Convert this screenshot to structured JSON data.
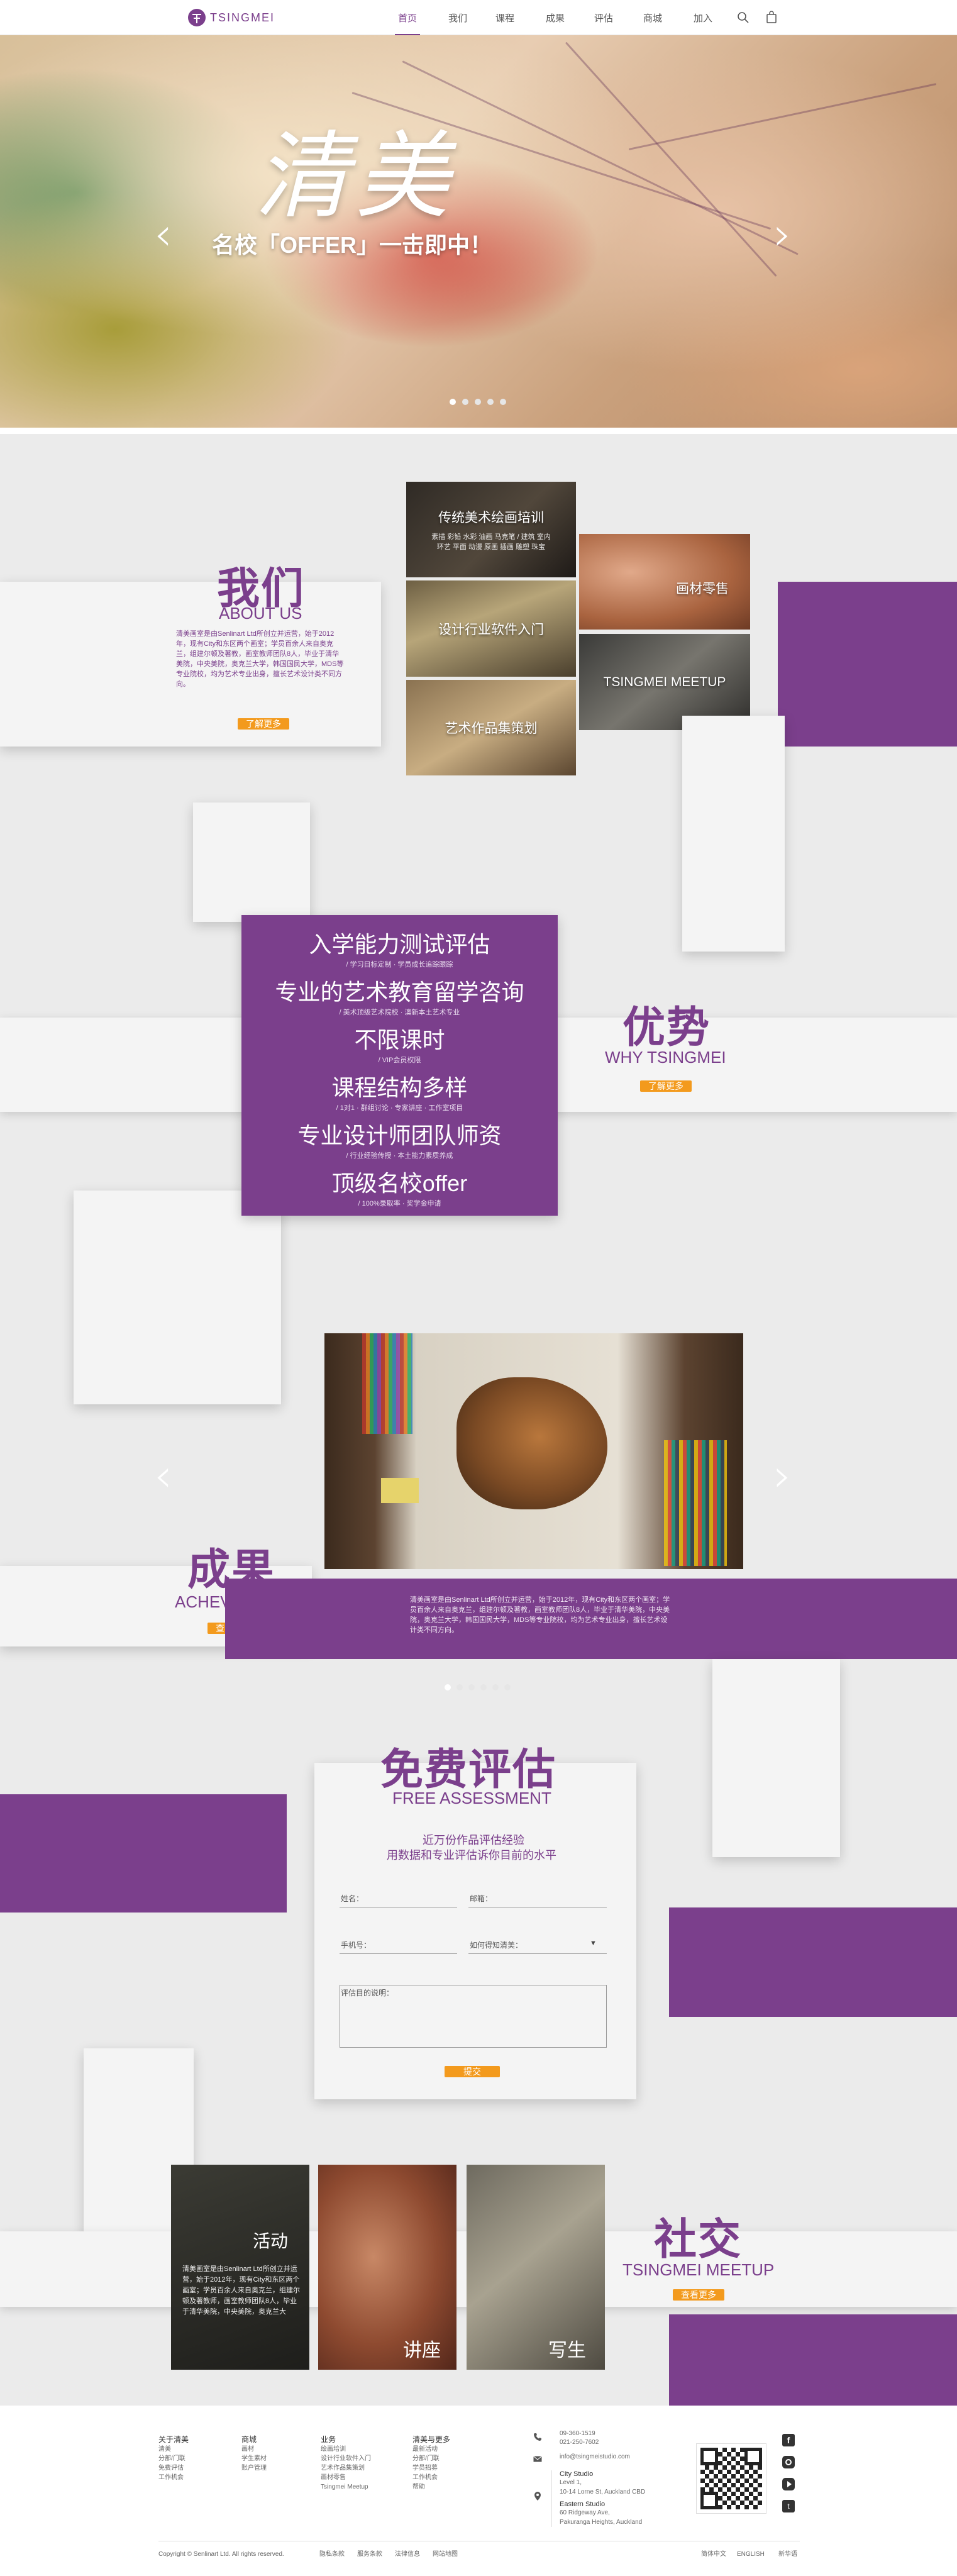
{
  "brand": {
    "logo_text": "TSINGMEI"
  },
  "nav": {
    "items": [
      {
        "label": "首页"
      },
      {
        "label": "我们"
      },
      {
        "label": "课程"
      },
      {
        "label": "成果"
      },
      {
        "label": "评估"
      },
      {
        "label": "商城"
      },
      {
        "label": "加入"
      }
    ]
  },
  "hero": {
    "calligraphy": "清美",
    "slogan": "名校「OFFER」一击即中！"
  },
  "about": {
    "title_cn": "我们",
    "title_en": "ABOUT US",
    "desc": "清美画室是由Senlinart Ltd所创立并运营，始于2012年，现有City和东区两个画室；学员百余人来自奥克兰，组建尔顿及著教，画室教师团队8人，毕业于清华美院，中央美院，奥克兰大学，韩国国民大学，MDS等专业院校，均为艺术专业出身，擅长艺术设计类不同方向。",
    "btn": "了解更多",
    "tiles": [
      {
        "title": "传统美术绘画培训",
        "sub": "素描 彩铅 水彩 油画 马克笔 / 建筑 室内 环艺 平面 动漫 原画 插画 雕塑 珠宝"
      },
      {
        "title": "画材零售"
      },
      {
        "title": "设计行业软件入门"
      },
      {
        "title": "TSINGMEI MEETUP"
      },
      {
        "title": "艺术作品集策划"
      }
    ]
  },
  "advantages": {
    "items": [
      {
        "main": "入学能力测试评估",
        "sub": "/ 学习目标定制 · 学员成长追踪跟踪"
      },
      {
        "main": "专业的艺术教育留学咨询",
        "sub": "/ 美术顶级艺术院校 · 澳新本土艺术专业"
      },
      {
        "main": "不限课时",
        "sub": "/ VIP会员权限"
      },
      {
        "main": "课程结构多样",
        "sub": "/ 1对1 · 群组讨论 · 专家讲座 · 工作室项目"
      },
      {
        "main": "专业设计师团队师资",
        "sub": "/ 行业经验传授 · 本土能力素质养成"
      },
      {
        "main": "顶级名校offer",
        "sub": "/ 100%录取率 · 奖学金申请"
      }
    ],
    "title_cn": "优势",
    "title_en": "WHY TSINGMEI",
    "btn": "了解更多"
  },
  "achievements": {
    "title_cn": "成果",
    "title_en": "ACHEVMENTS",
    "btn": "查看更多",
    "desc": "清美画室是由Senlinart Ltd所创立并运营，始于2012年，现有City和东区两个画室；学员百余人来自奥克兰，组建尔顿及著教，画室教师团队8人，毕业于清华美院，中央美院，奥克兰大学，韩国国民大学，MDS等专业院校，均为艺术专业出身，擅长艺术设计类不同方向。"
  },
  "assessment": {
    "title_cn": "免费评估",
    "title_en": "FREE ASSESSMENT",
    "line1": "近万份作品评估经验",
    "line2": "用数据和专业评估诉你目前的水平",
    "name_label": "姓名：",
    "email_label": "邮箱：",
    "phone_label": "手机号：",
    "source_label": "如何得知清美：",
    "desc_label": "评估目的说明：",
    "submit": "提交"
  },
  "social": {
    "title_cn": "社交",
    "title_en": "TSINGMEI MEETUP",
    "btn": "查看更多",
    "card1_title": "活动",
    "card1_text": "清美画室是由Senlinart Ltd所创立并运营，始于2012年，现有City和东区两个画室；学员百余人来自奥克兰，组建尔顿及著教师，画室教师团队8人，毕业于清华美院，中央美院，奥克兰大",
    "card2_title": "讲座",
    "card3_title": "写生"
  },
  "footer": {
    "cols": [
      {
        "head": "关于清美",
        "links": [
          "清美",
          "分部/门联",
          "免费评估",
          "工作机会"
        ]
      },
      {
        "head": "商城",
        "links": [
          "画材",
          "学生素材",
          "账户管理"
        ]
      },
      {
        "head": "业务",
        "links": [
          "绘画培训",
          "设计行业软件入门",
          "艺术作品集策划",
          "画材零售",
          "Tsingmei Meetup"
        ]
      },
      {
        "head": "清美与更多",
        "links": [
          "最新活动",
          "分部/门联",
          "学员招募",
          "工作机会",
          "帮助"
        ]
      }
    ],
    "phone1": "09-360-1519",
    "phone2": "021-250-7602",
    "email": "info@tsingmeistudio.com",
    "city_studio": "City Studio",
    "city_addr1": "Level 1,",
    "city_addr2": "10-14 Lorne St, Auckland CBD",
    "eastern_studio": "Eastern Studio",
    "eastern_addr1": "60 Ridgeway Ave,",
    "eastern_addr2": "Pakuranga Heights, Auckland",
    "copyright": "Copyright © Senlinart Ltd. All rights reserved.",
    "legal": [
      "隐私条款",
      "服务条款",
      "法律信息",
      "网站地图"
    ],
    "langs": [
      "简体中文",
      "ENGLISH",
      "新华语"
    ]
  },
  "colors": {
    "accent": "#7b3f8c",
    "button": "#f39a1d"
  }
}
